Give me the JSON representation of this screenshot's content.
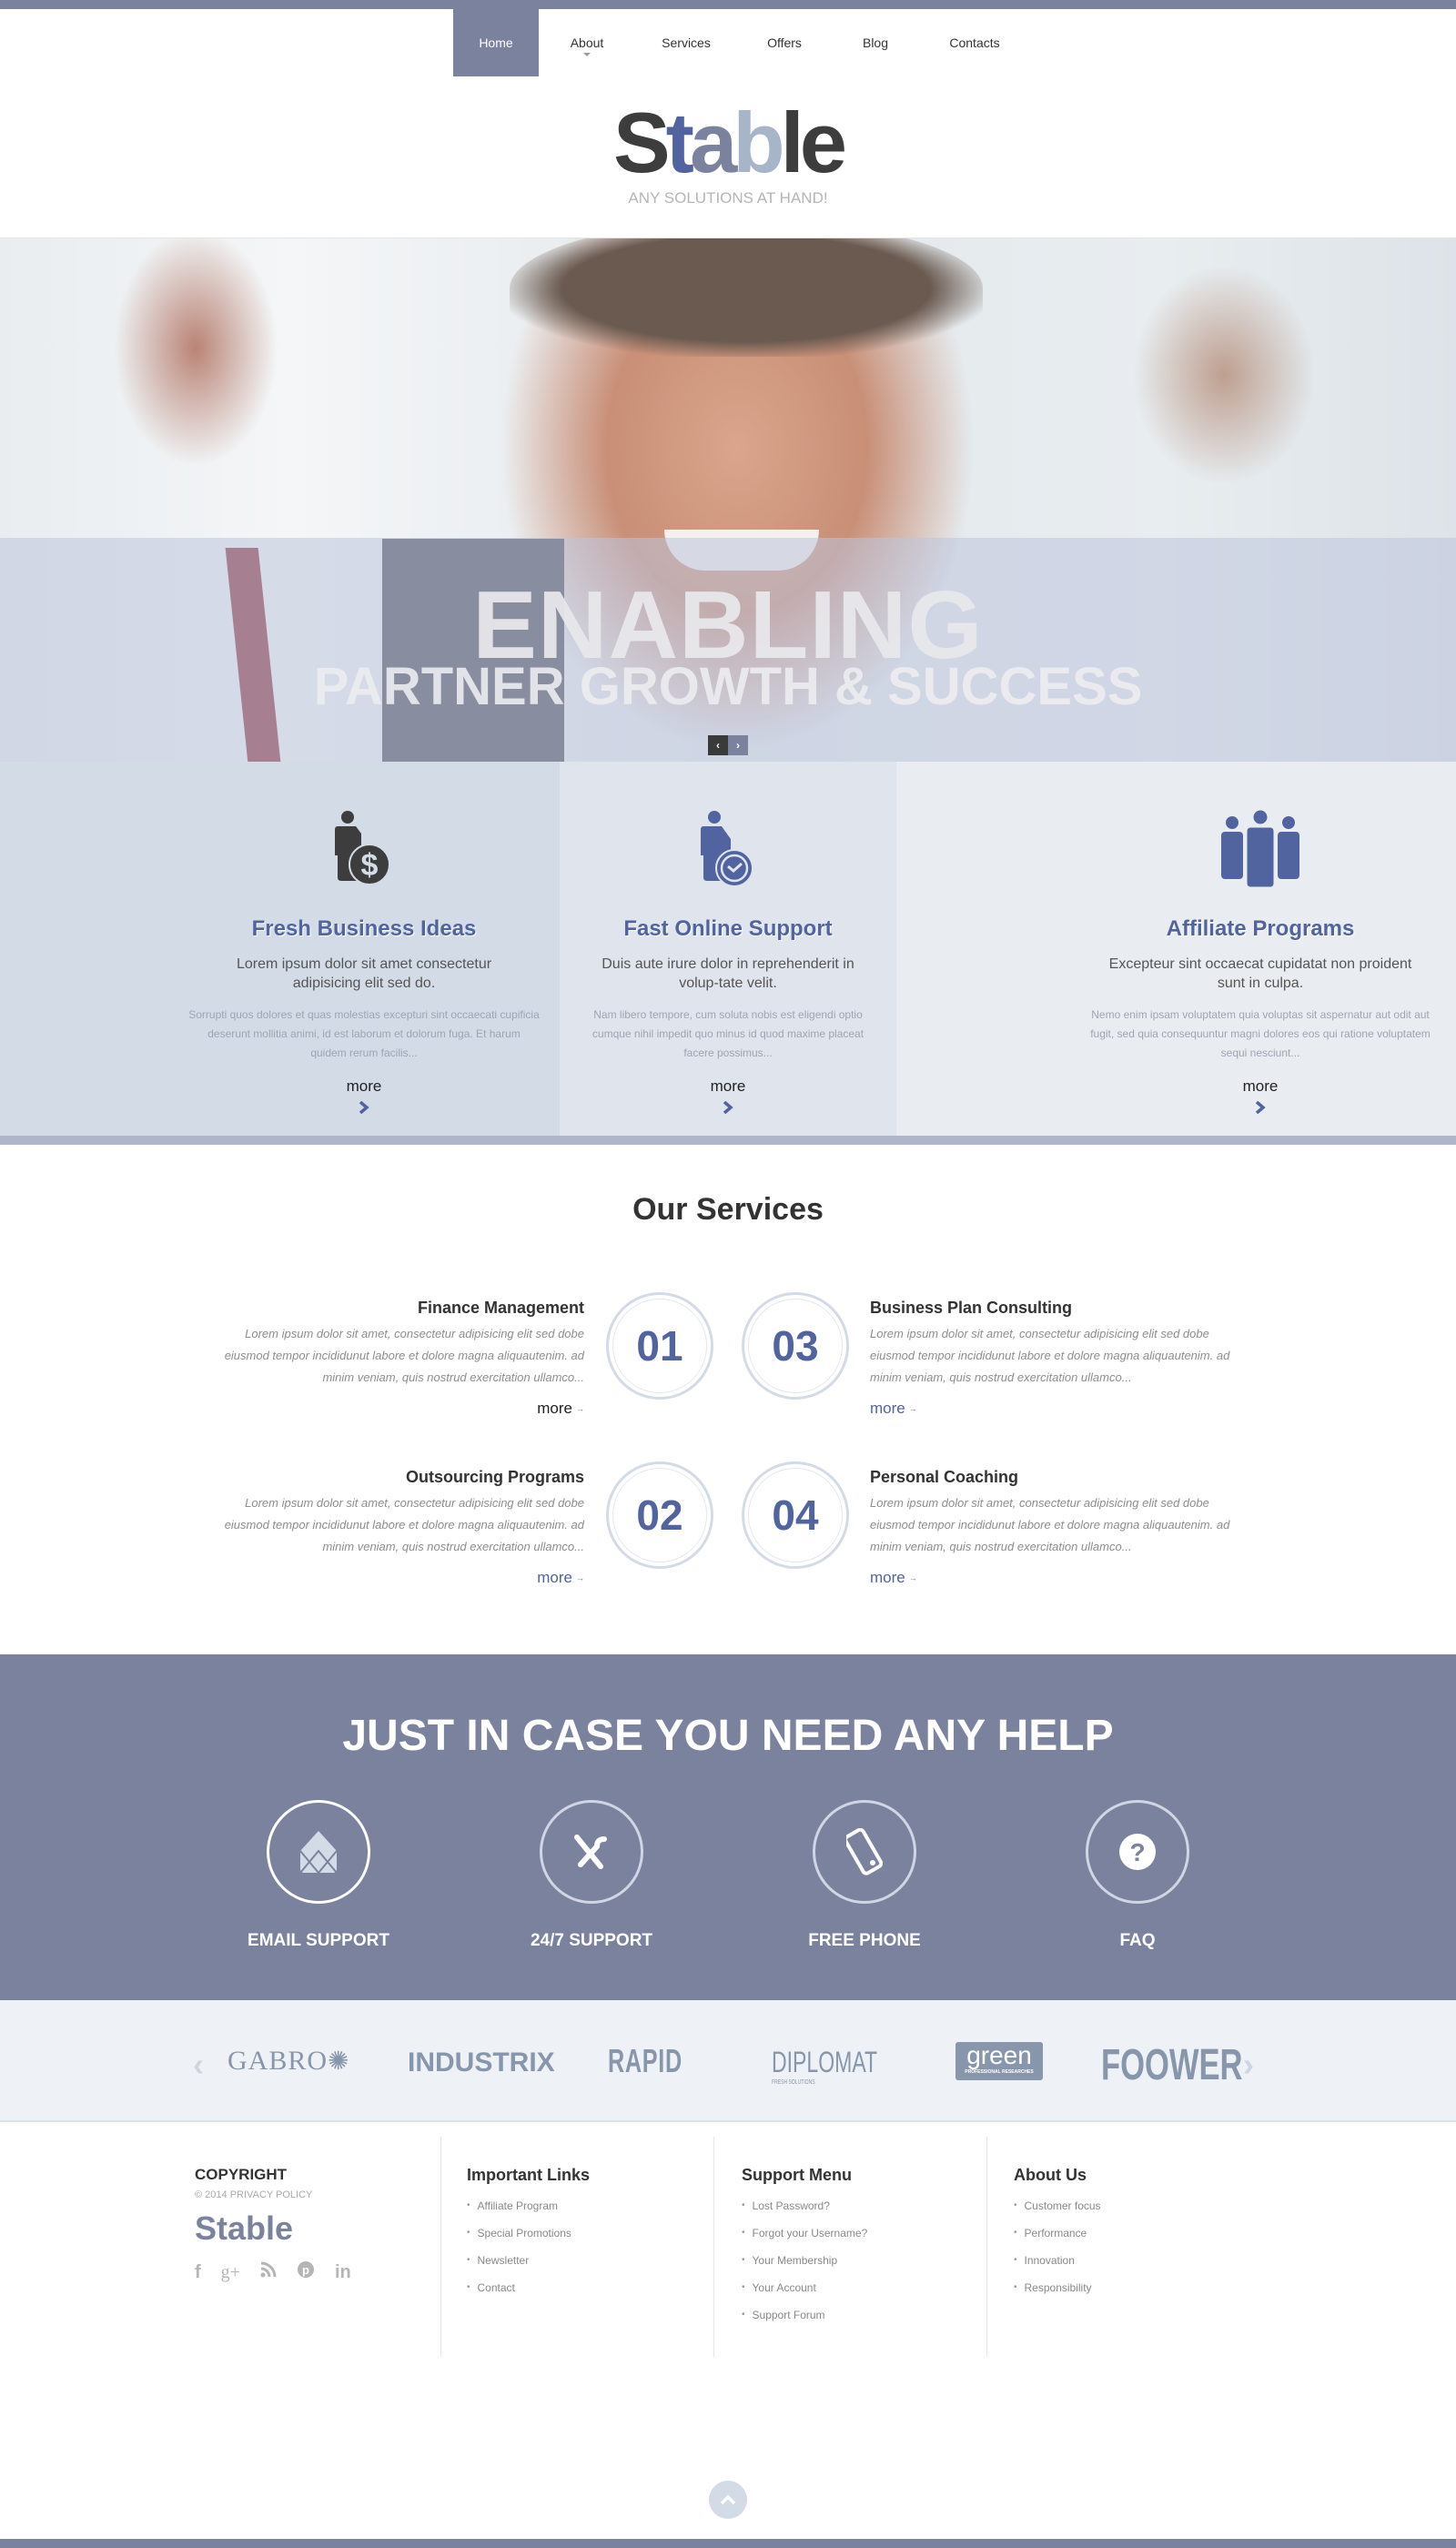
{
  "nav": {
    "items": [
      {
        "label": "Home",
        "active": true
      },
      {
        "label": "About",
        "has_dropdown": true
      },
      {
        "label": "Services"
      },
      {
        "label": "Offers"
      },
      {
        "label": "Blog"
      },
      {
        "label": "Contacts"
      }
    ]
  },
  "logo": {
    "parts": [
      "S",
      "t",
      "a",
      "b",
      "le"
    ],
    "tagline": "ANY SOLUTIONS AT HAND!"
  },
  "hero": {
    "title": "ENABLING",
    "subtitle": "PARTNER GROWTH & SUCCESS",
    "prev_icon": "‹",
    "next_icon": "›"
  },
  "features": [
    {
      "icon": "businessman-dollar-icon",
      "title": "Fresh Business Ideas",
      "lead": "Lorem ipsum dolor sit amet consectetur adipisicing elit sed do.",
      "body": "Sorrupti quos dolores et quas molestias excepturi sint occaecati cupificia deserunt mollitia animi, id est laborum et dolorum fuga. Et harum quidem rerum facilis...",
      "more": "more"
    },
    {
      "icon": "businessman-clock-icon",
      "title": "Fast Online Support",
      "lead": "Duis aute irure dolor in reprehenderit in volup-tate velit.",
      "body": "Nam libero tempore, cum soluta nobis est eligendi optio cumque nihil impedit quo minus id quod maxime placeat facere possimus...",
      "more": "more"
    },
    {
      "icon": "group-people-icon",
      "title": "Affiliate Programs",
      "lead": "Excepteur sint occaecat cupidatat non proident sunt in culpa.",
      "body": "Nemo enim ipsam voluptatem quia voluptas sit aspernatur aut odit aut fugit, sed quia consequuntur magni dolores eos qui ratione voluptatem sequi nesciunt...",
      "more": "more"
    }
  ],
  "services": {
    "title": "Our Services",
    "items": [
      {
        "num": "01",
        "title": "Finance Management",
        "text": "Lorem ipsum dolor sit amet, consectetur adipisicing elit sed dobe eiusmod tempor incididunut labore et dolore magna aliquautenim. ad minim veniam, quis nostrud exercitation ullamco...",
        "more": "more",
        "arrow": "→"
      },
      {
        "num": "02",
        "title": "Outsourcing Programs",
        "text": "Lorem ipsum dolor sit amet, consectetur adipisicing elit sed dobe eiusmod tempor incididunut labore et dolore magna aliquautenim. ad minim veniam, quis nostrud exercitation ullamco...",
        "more": "more",
        "arrow": "→"
      },
      {
        "num": "03",
        "title": "Business Plan Consulting",
        "text": "Lorem ipsum dolor sit amet, consectetur adipisicing elit sed dobe eiusmod tempor incididunut labore et dolore magna aliquautenim. ad minim veniam, quis nostrud exercitation ullamco...",
        "more": "more",
        "arrow": "→"
      },
      {
        "num": "04",
        "title": "Personal Coaching",
        "text": "Lorem ipsum dolor sit amet, consectetur adipisicing elit sed dobe eiusmod tempor incididunut labore et dolore magna aliquautenim. ad minim veniam, quis nostrud exercitation ullamco...",
        "more": "more",
        "arrow": "→"
      }
    ]
  },
  "help": {
    "title": "JUST IN CASE YOU NEED ANY HELP",
    "items": [
      {
        "label": "EMAIL SUPPORT",
        "icon": "envelope-icon"
      },
      {
        "label": "24/7 SUPPORT",
        "icon": "tools-icon"
      },
      {
        "label": "FREE PHONE",
        "icon": "phone-icon"
      },
      {
        "label": "FAQ",
        "icon": "question-icon"
      }
    ]
  },
  "clients": {
    "prev_icon": "‹",
    "next_icon": "›",
    "logos": [
      "GABRO",
      "INDUSTRIX",
      "RAPID",
      "DIPLOMAT",
      "green",
      "FOOWER"
    ],
    "diplomat_sub": "FRESH SOLUTIONS",
    "green_sub": "PROFESSIONAL RESEARCHES"
  },
  "footer": {
    "copyright_title": "COPYRIGHT",
    "copyright_sub": "© 2014 PRIVACY POLICY",
    "logo": "Stable",
    "social": [
      {
        "name": "facebook",
        "glyph": "f"
      },
      {
        "name": "google-plus",
        "glyph": "g+"
      },
      {
        "name": "rss",
        "glyph": "∴"
      },
      {
        "name": "pinterest",
        "glyph": "P"
      },
      {
        "name": "linkedin",
        "glyph": "in"
      }
    ],
    "columns": [
      {
        "title": "Important Links",
        "links": [
          "Affiliate Program",
          "Special Promotions",
          "Newsletter",
          "Contact"
        ]
      },
      {
        "title": "Support Menu",
        "links": [
          "Lost Password?",
          "Forgot your Username?",
          "Your Membership",
          "Your Account",
          "Support Forum"
        ]
      },
      {
        "title": "About Us",
        "links": [
          "Customer focus",
          "Performance",
          "Innovation",
          "Responsibility"
        ]
      }
    ]
  },
  "colors": {
    "brand_slate": "#7b829e",
    "brand_blue": "#5164a0",
    "light_blue": "#d2dbe6",
    "logo_gray": "#3d3d3d",
    "logo_pale": "#a7b5c9"
  }
}
